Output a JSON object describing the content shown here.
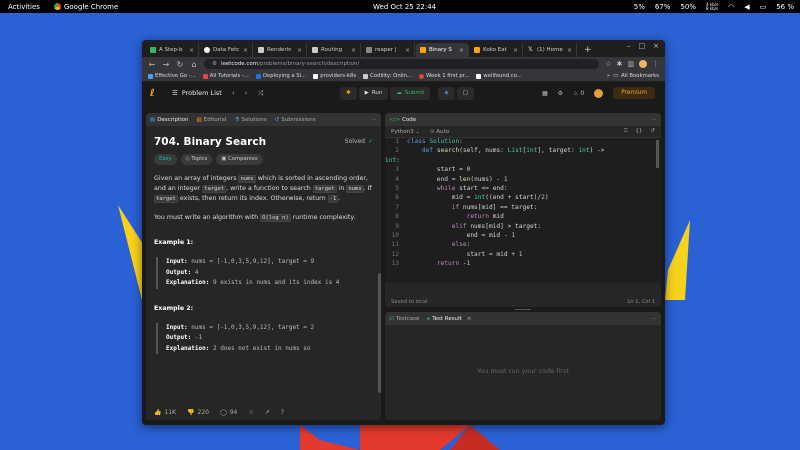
{
  "topbar": {
    "activities": "Activities",
    "app_name": "Google Chrome",
    "clock": "Wed Oct 25  22:44",
    "indicators": [
      "5%",
      "67%",
      "50%"
    ],
    "net_up": "4 kb/s",
    "net_down": "8 kb/s",
    "battery": "56 %"
  },
  "browser": {
    "tabs": [
      {
        "label": "A Step-b",
        "fav": "#2cbb5d"
      },
      {
        "label": "Data Fetc",
        "fav": "#ffffff"
      },
      {
        "label": "Renderin",
        "fav": "#cccccc"
      },
      {
        "label": "Routing",
        "fav": "#cccccc"
      },
      {
        "label": "reaper |",
        "fav": "#888888"
      },
      {
        "label": "Binary S",
        "fav": "#ffa116"
      },
      {
        "label": "Koko Eat",
        "fav": "#ffa116"
      },
      {
        "label": "(1) Home",
        "fav": "#ffffff"
      }
    ],
    "url_host": "leetcode.com",
    "url_path": "/problems/binary-search/description/",
    "bookmarks": [
      {
        "label": "Effective Go -...",
        "fav": "#4a9eff"
      },
      {
        "label": "All Tutorials -...",
        "fav": "#e8453c"
      },
      {
        "label": "Deploying a Si...",
        "fav": "#1a73e8"
      },
      {
        "label": "providers-k8s",
        "fav": "#ffffff"
      },
      {
        "label": "Codility: Onlin...",
        "fav": "#cccccc"
      },
      {
        "label": "Week 1 first pr...",
        "fav": "#e8453c"
      },
      {
        "label": "wellfound.co...",
        "fav": "#ffffff"
      }
    ],
    "all_bookmarks": "All Bookmarks"
  },
  "lc": {
    "problem_list": "Problem List",
    "run": "Run",
    "submit": "Submit",
    "streak": "0",
    "premium": "Premium"
  },
  "desc": {
    "tabs": [
      "Description",
      "Editorial",
      "Solutions",
      "Submissions"
    ],
    "title": "704. Binary Search",
    "solved": "Solved",
    "chips": [
      "Easy",
      "Topics",
      "Companies"
    ],
    "p1_a": "Given an array of integers ",
    "p1_nums": "nums",
    "p1_b": " which is sorted in ascending order, and an integer ",
    "p1_target": "target",
    "p1_c": ", write a function to search ",
    "p1_target2": "target",
    "p1_d": " in ",
    "p1_nums2": "nums",
    "p1_e": ". If ",
    "p1_target3": "target",
    "p1_f": " exists, then return its index. Otherwise, return ",
    "p1_neg": "-1",
    "p1_g": ".",
    "p2_a": "You must write an algorithm with ",
    "p2_code": "O(log n)",
    "p2_b": " runtime complexity.",
    "ex1_title": "Example 1:",
    "ex1_input_label": "Input:",
    "ex1_input": " nums = [-1,0,3,5,9,12], target = 9",
    "ex1_output_label": "Output:",
    "ex1_output": " 4",
    "ex1_expl_label": "Explanation:",
    "ex1_expl": " 9 exists in nums and its index is 4",
    "ex2_title": "Example 2:",
    "ex2_input_label": "Input:",
    "ex2_input": " nums = [-1,0,3,5,9,12], target = 2",
    "ex2_output_label": "Output:",
    "ex2_output": " -1",
    "ex2_expl_label": "Explanation:",
    "ex2_expl": " 2 does not exist in nums so",
    "likes": "11K",
    "dislikes": "220",
    "comments": "94"
  },
  "code": {
    "tab": "Code",
    "language": "Python3",
    "auto": "Auto",
    "status_left": "Saved to local",
    "status_right": "Ln 1, Col 1"
  },
  "test": {
    "tab1": "Testcase",
    "tab2": "Test Result",
    "empty": "You must run your code first"
  }
}
